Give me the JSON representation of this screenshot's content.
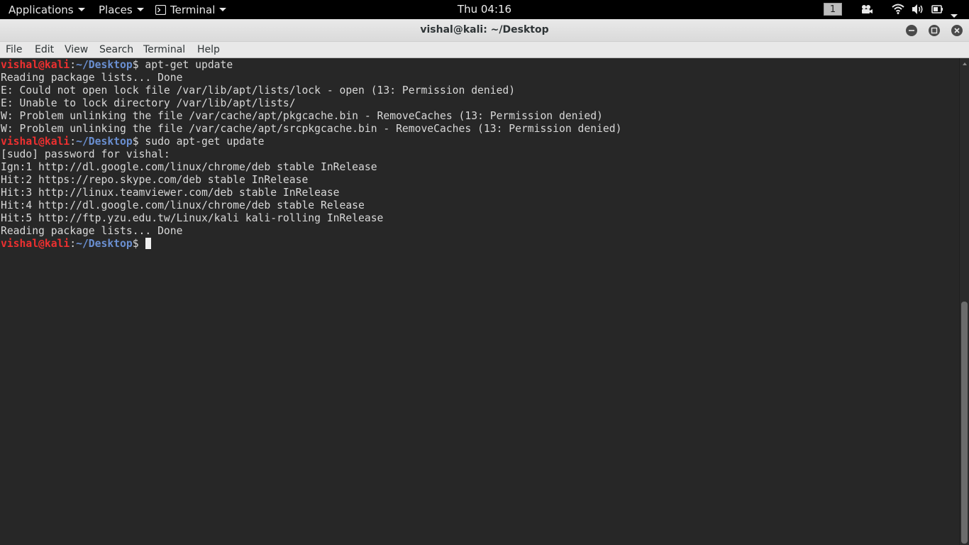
{
  "topbar": {
    "applications_label": "Applications",
    "places_label": "Places",
    "terminal_label": "Terminal",
    "clock": "Thu 04:16",
    "workspace": "1",
    "icons": [
      "terminal-icon",
      "camera-icon",
      "wifi-icon",
      "volume-icon",
      "battery-icon",
      "chevron-down-icon"
    ]
  },
  "window": {
    "title": "vishal@kali: ~/Desktop",
    "buttons": [
      "minimize-icon",
      "maximize-icon",
      "close-icon"
    ]
  },
  "menubar": {
    "items": [
      "File",
      "Edit",
      "View",
      "Search",
      "Terminal",
      "Help"
    ]
  },
  "terminal": {
    "prompt_user": "vishal@kali",
    "prompt_colon": ":",
    "prompt_path": "~/Desktop",
    "prompt_suffix": "$",
    "lines": [
      {
        "type": "prompt",
        "command": " apt-get update"
      },
      {
        "type": "output",
        "text": "Reading package lists... Done"
      },
      {
        "type": "output",
        "text": "E: Could not open lock file /var/lib/apt/lists/lock - open (13: Permission denied)"
      },
      {
        "type": "output",
        "text": "E: Unable to lock directory /var/lib/apt/lists/"
      },
      {
        "type": "output",
        "text": "W: Problem unlinking the file /var/cache/apt/pkgcache.bin - RemoveCaches (13: Permission denied)"
      },
      {
        "type": "output",
        "text": "W: Problem unlinking the file /var/cache/apt/srcpkgcache.bin - RemoveCaches (13: Permission denied)"
      },
      {
        "type": "prompt",
        "command": " sudo apt-get update"
      },
      {
        "type": "output",
        "text": "[sudo] password for vishal:"
      },
      {
        "type": "output",
        "text": "Ign:1 http://dl.google.com/linux/chrome/deb stable InRelease"
      },
      {
        "type": "output",
        "text": "Hit:2 https://repo.skype.com/deb stable InRelease"
      },
      {
        "type": "output",
        "text": "Hit:3 http://linux.teamviewer.com/deb stable InRelease"
      },
      {
        "type": "output",
        "text": "Hit:4 http://dl.google.com/linux/chrome/deb stable Release"
      },
      {
        "type": "output",
        "text": "Hit:5 http://ftp.yzu.edu.tw/Linux/kali kali-rolling InRelease"
      },
      {
        "type": "output",
        "text": "Reading package lists... Done"
      },
      {
        "type": "prompt",
        "command": " ",
        "cursor": true
      }
    ]
  }
}
